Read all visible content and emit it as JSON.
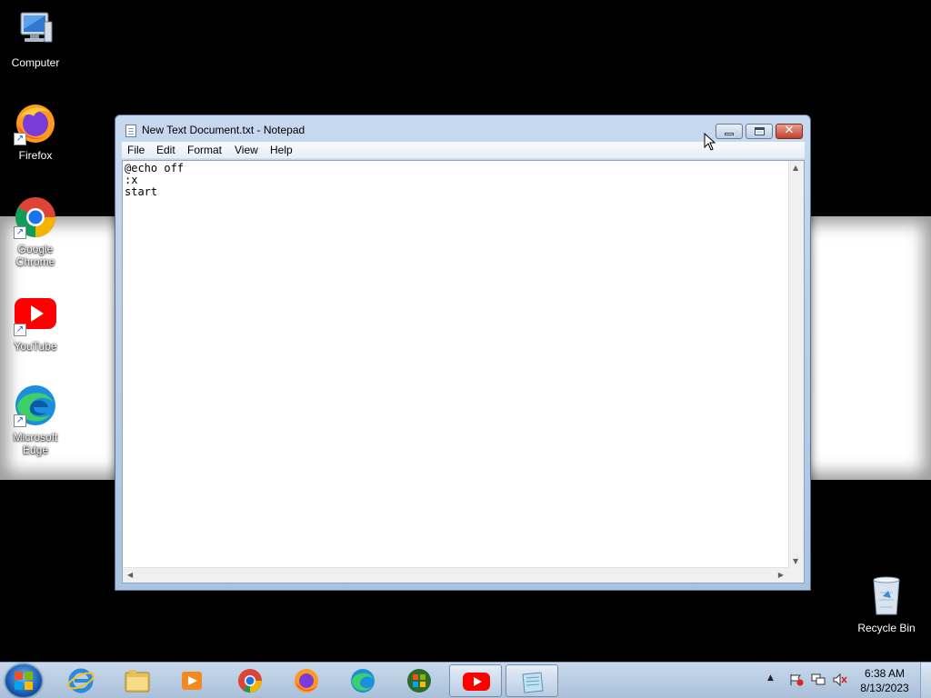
{
  "desktop": {
    "icons": [
      {
        "label": "Computer"
      },
      {
        "label": "Firefox"
      },
      {
        "label": "Google Chrome"
      },
      {
        "label": "YouTube"
      },
      {
        "label": "Microsoft Edge"
      },
      {
        "label": "Recycle Bin"
      }
    ]
  },
  "window": {
    "title": "New Text Document.txt - Notepad",
    "menu": [
      "File",
      "Edit",
      "Format",
      "View",
      "Help"
    ],
    "content": "@echo off\n:x\nstart"
  },
  "taskbar": {
    "pinned": [
      "internet-explorer",
      "file-explorer",
      "media-player",
      "chrome",
      "firefox",
      "edge",
      "windows-logo",
      "youtube",
      "notepad"
    ],
    "clock": {
      "time": "6:38 AM",
      "date": "8/13/2023"
    }
  }
}
